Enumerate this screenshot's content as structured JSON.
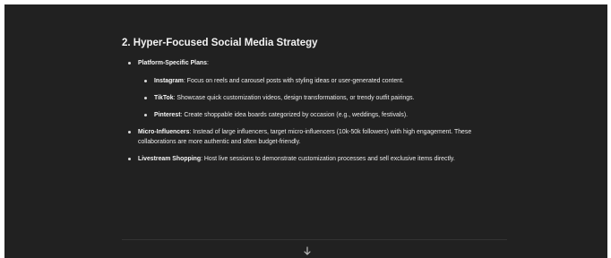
{
  "section": {
    "heading": "2. Hyper-Focused Social Media Strategy",
    "platform_plans": {
      "label": "Platform-Specific Plans",
      "suffix": ":",
      "items": [
        {
          "platform": "Instagram",
          "sep": ":",
          "text": " Focus on reels and carousel posts with styling ideas or user-generated content."
        },
        {
          "platform": "TikTok",
          "sep": ":",
          "text": " Showcase quick customization videos, design transformations, or trendy outfit pairings."
        },
        {
          "platform": "Pinterest",
          "sep": ":",
          "text": " Create shoppable idea boards categorized by occasion (e.g., weddings, festivals)."
        }
      ]
    },
    "micro_influencers": {
      "label": "Micro-Influencers",
      "sep": ":",
      "text": " Instead of large influencers, target micro-influencers (10k-50k followers) with high engagement. These collaborations are more authentic and often budget-friendly."
    },
    "livestream": {
      "label": "Livestream Shopping",
      "sep": ":",
      "text": " Host live sessions to demonstrate customization processes and sell exclusive items directly."
    }
  },
  "scroll_down": {
    "icon": "arrow-down-icon"
  },
  "colors": {
    "background": "#212121",
    "text": "#ececec",
    "outer": "#ffffff"
  }
}
